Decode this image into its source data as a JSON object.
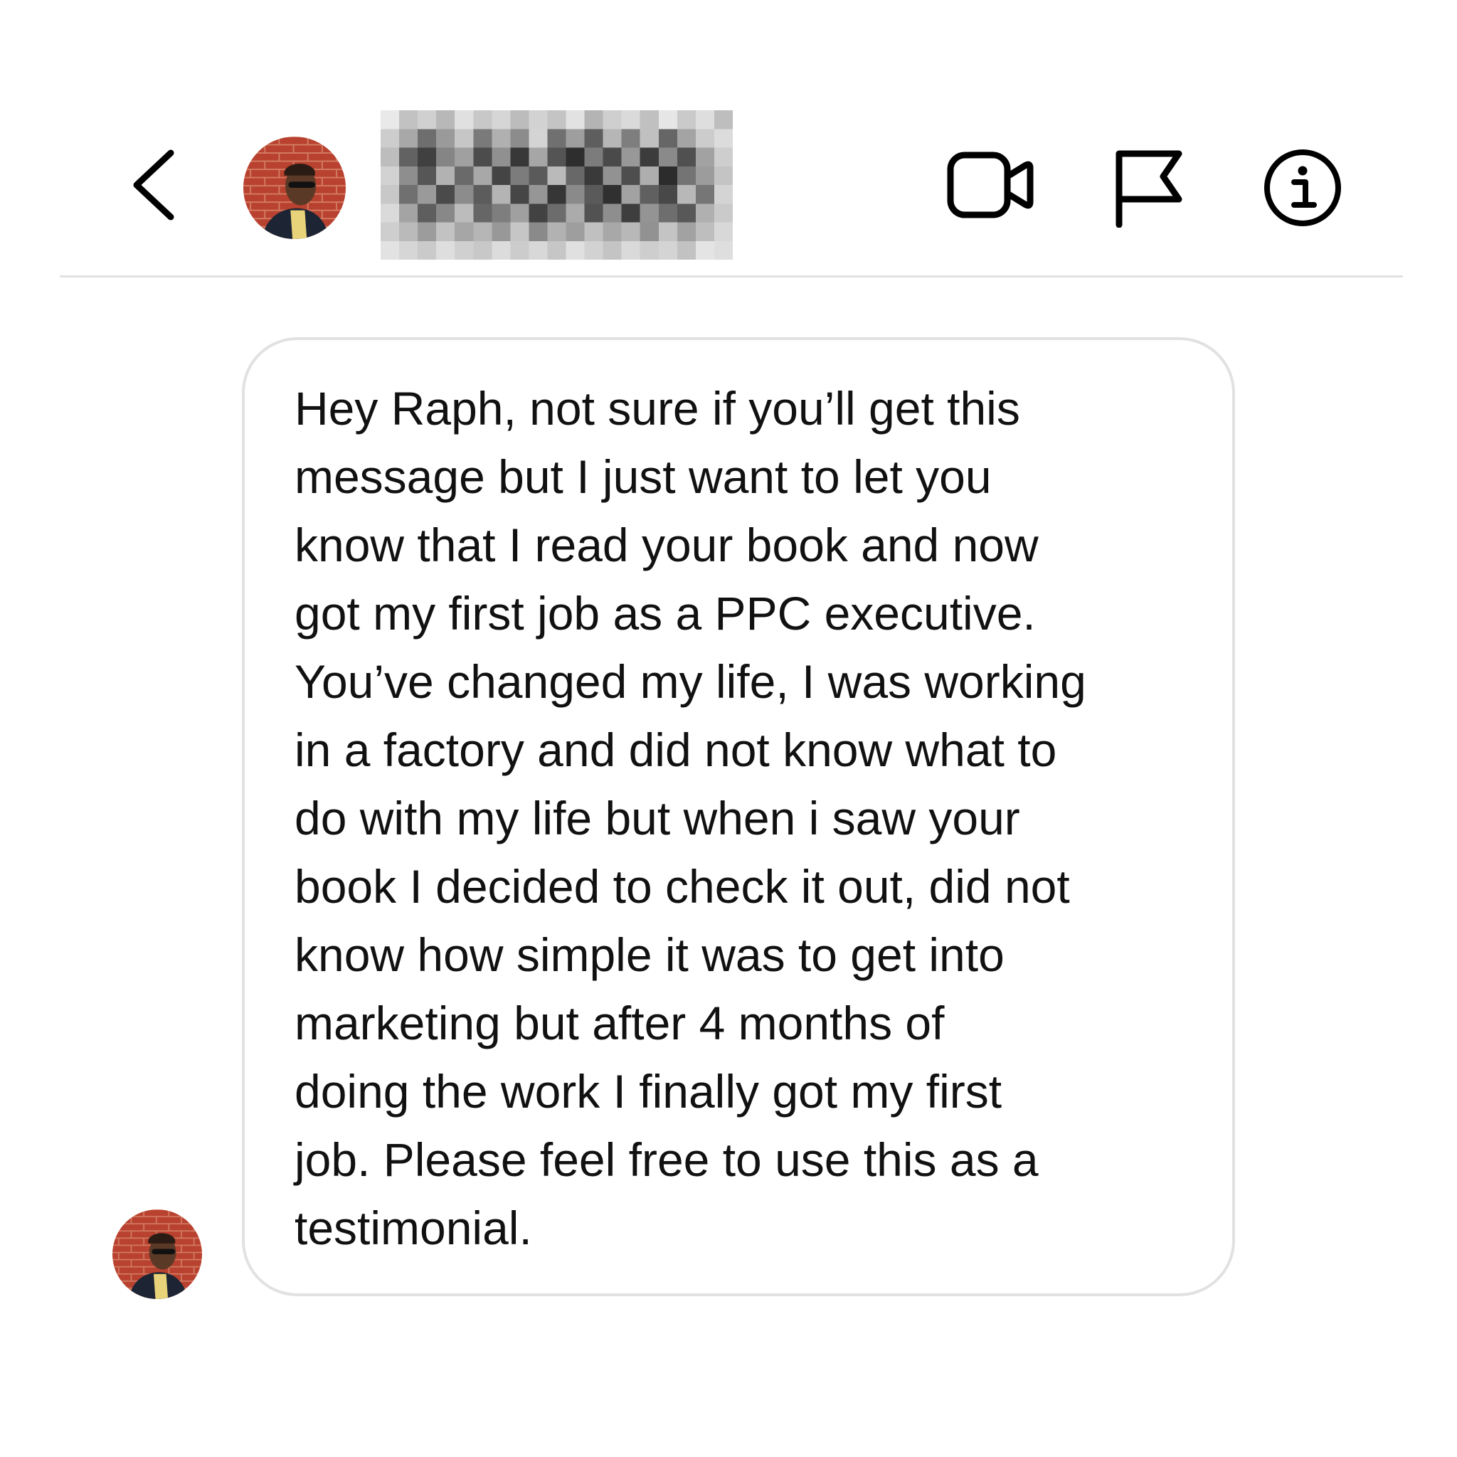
{
  "header": {
    "back_icon": "chevron-left-icon",
    "contact_avatar_icon": "profile-avatar",
    "contact_name": "",
    "contact_name_obscured": true,
    "actions": [
      {
        "name": "video-call",
        "icon": "video-camera-icon"
      },
      {
        "name": "report",
        "icon": "flag-icon"
      },
      {
        "name": "info",
        "icon": "info-circle-icon"
      }
    ]
  },
  "conversation": {
    "messages": [
      {
        "sender_avatar_icon": "profile-avatar",
        "lines": [
          "Hey Raph, not sure if you’ll get this",
          "message but I just want to let you",
          "know that I read your book and now",
          "got my first job as a PPC executive.",
          "You’ve changed my life, I was working",
          "in a factory and did not know what to",
          "do with my life but when i saw your",
          "book I decided to check it out, did not",
          "know how simple it was to get into",
          "marketing but after 4 months of",
          "doing the work I finally got my first",
          "job. Please feel free to use this as a",
          "testimonial."
        ]
      }
    ]
  },
  "colors": {
    "background": "#ffffff",
    "divider": "#e2e2e2",
    "bubble_border": "#e1e1e1",
    "text": "#111111",
    "avatar_brick": "#b23a2a"
  }
}
